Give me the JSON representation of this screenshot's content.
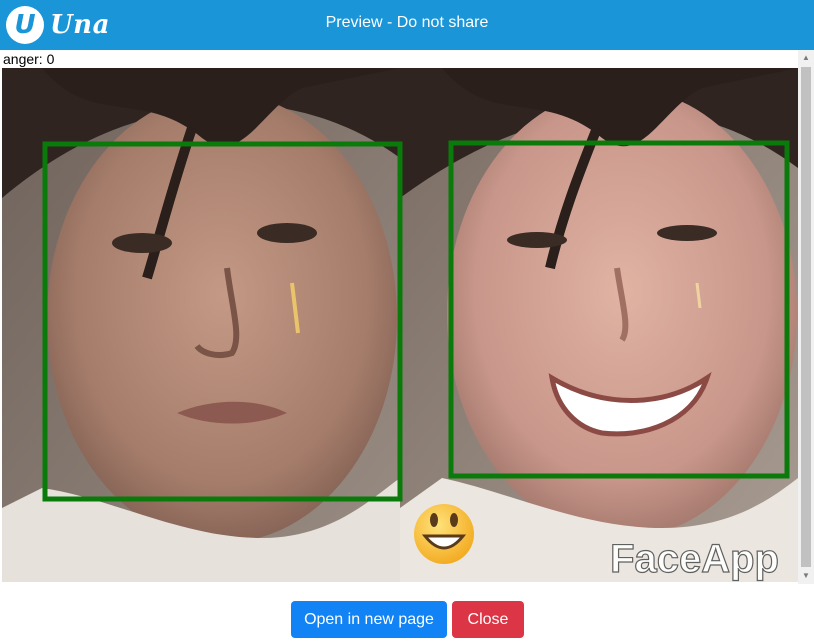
{
  "header": {
    "logo_letter": "U",
    "logo_text": "Una",
    "title": "Preview - Do not share"
  },
  "preview": {
    "caption": "anger: 0",
    "image_alt": "Before and after face comparison with detection boxes",
    "watermark": "FaceApp",
    "emoji": "😀"
  },
  "footer": {
    "open_label": "Open in new page",
    "close_label": "Close"
  },
  "colors": {
    "header_bg": "#1a95d8",
    "open_button": "#1283f5",
    "close_button": "#dc3545",
    "face_box": "#0a7a0a"
  }
}
